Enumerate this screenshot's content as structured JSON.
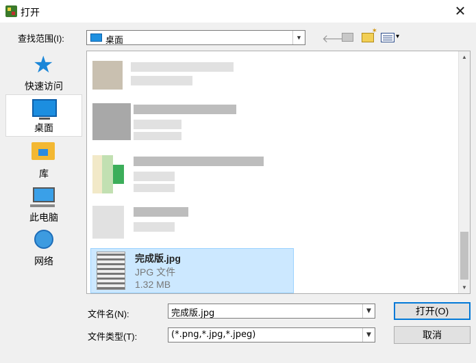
{
  "window": {
    "title": "打开",
    "close_glyph": "✕"
  },
  "lookin": {
    "label": "查找范围(I):",
    "value": "桌面"
  },
  "toolbar": {
    "back_glyph": "🡐",
    "view_arrow": "▾"
  },
  "places": [
    {
      "label": "快速访问",
      "icon": "star-icon"
    },
    {
      "label": "桌面",
      "icon": "desktop-icon",
      "active": true
    },
    {
      "label": "库",
      "icon": "library-icon"
    },
    {
      "label": "此电脑",
      "icon": "computer-icon"
    },
    {
      "label": "网络",
      "icon": "network-icon"
    }
  ],
  "files": {
    "selected": {
      "name": "完成版.jpg",
      "type": "JPG 文件",
      "size": "1.32 MB"
    }
  },
  "filename": {
    "label": "文件名(N):",
    "value": "完成版.jpg"
  },
  "filetype": {
    "label": "文件类型(T):",
    "value": "(*.png,*.jpg,*.jpeg)"
  },
  "buttons": {
    "open": "打开(O)",
    "cancel": "取消"
  },
  "colors": {
    "selection_bg": "#cce8ff",
    "selection_border": "#99d1ff",
    "accent": "#0078d7"
  }
}
